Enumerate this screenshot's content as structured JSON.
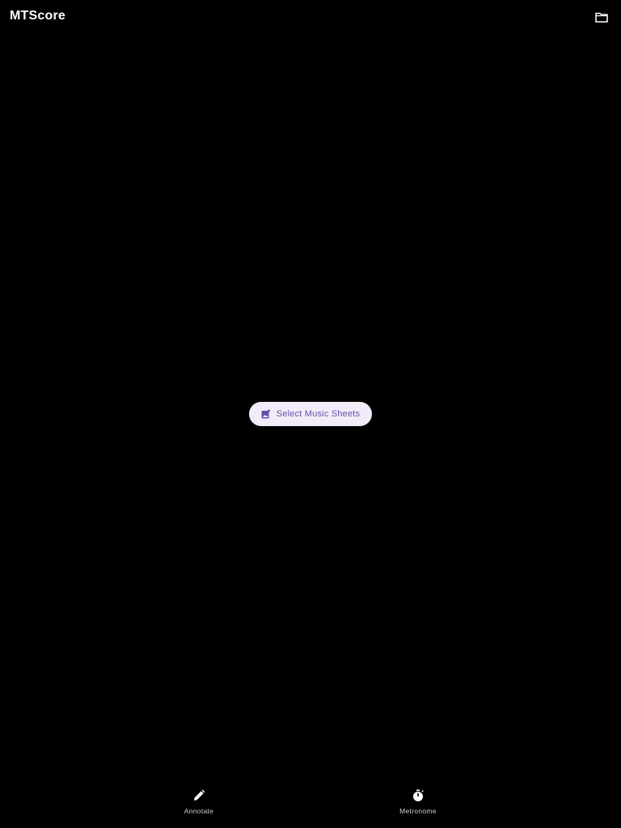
{
  "app_bar": {
    "title": "MTScore",
    "folder_icon": "folder-icon"
  },
  "main": {
    "select_button": {
      "label": "Select Music Sheets",
      "icon": "add-photo-icon"
    }
  },
  "bottom_nav": {
    "items": [
      {
        "label": "Annotate",
        "icon": "pencil-icon"
      },
      {
        "label": "Metronome",
        "icon": "stopwatch-icon"
      }
    ]
  },
  "colors": {
    "background": "#000000",
    "button_bg": "#f2ecf8",
    "button_text": "#6a4fa8",
    "nav_label": "#cfcfcf"
  }
}
